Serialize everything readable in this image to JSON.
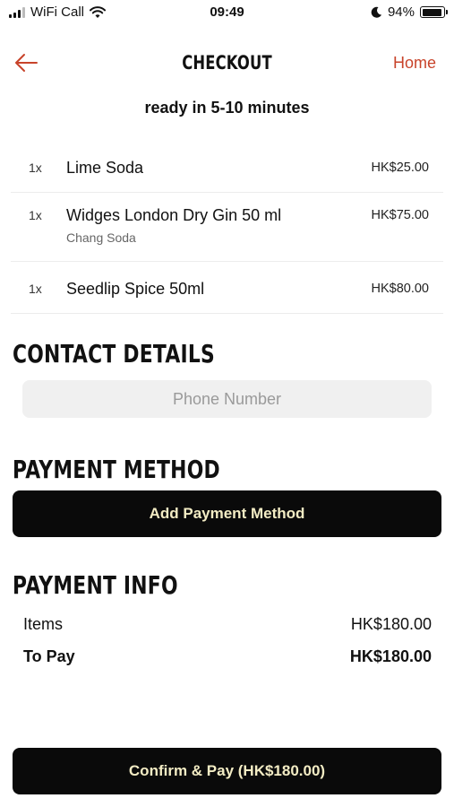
{
  "status_bar": {
    "carrier": "WiFi Call",
    "time": "09:49",
    "battery": "94%",
    "battery_level": 0.94
  },
  "header": {
    "title": "CHECKOUT",
    "home_label": "Home",
    "back_icon": "arrow-left-icon",
    "accent_color": "#c8432a"
  },
  "ready_text": "ready in 5-10 minutes",
  "order_items": [
    {
      "qty": "1x",
      "name": "Lime Soda",
      "modifier": "",
      "price": "HK$25.00"
    },
    {
      "qty": "1x",
      "name": "Widges London Dry Gin 50 ml",
      "modifier": "Chang Soda",
      "price": "HK$75.00"
    },
    {
      "qty": "1x",
      "name": "Seedlip Spice 50ml",
      "modifier": "",
      "price": "HK$80.00"
    }
  ],
  "contact": {
    "title": "CONTACT DETAILS",
    "phone_placeholder": "Phone Number",
    "phone_value": ""
  },
  "payment_method": {
    "title": "PAYMENT METHOD",
    "button_label": "Add Payment Method"
  },
  "payment_info": {
    "title": "PAYMENT INFO",
    "items_label": "Items",
    "items_value": "HK$180.00",
    "to_pay_label": "To Pay",
    "to_pay_value": "HK$180.00"
  },
  "confirm_button": "Confirm & Pay (HK$180.00)"
}
